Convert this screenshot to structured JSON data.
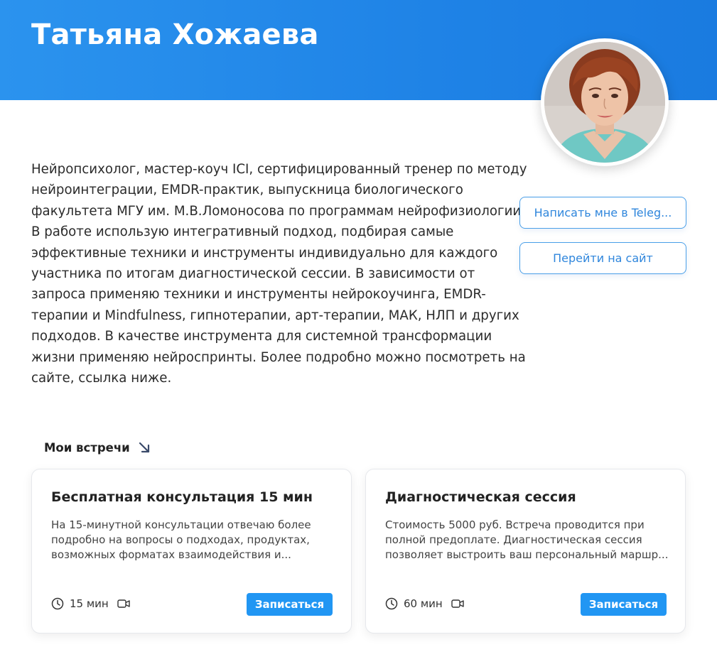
{
  "profile": {
    "name": "Татьяна Хожаева",
    "bio_lines": [
      "Нейропсихолог, мастер-коуч ICI, сертифицированный тренер по методу",
      "нейроинтеграции, EMDR-практик, выпускница биологического",
      "факультета МГУ им. М.В.Ломоносова по программам нейрофизиологии.",
      "В работе использую интегративный подход, подбирая самые",
      "эффективные техники и инструменты индивидуально для каждого",
      "участника по итогам диагностической сессии. В зависимости от",
      "запроса применяю техники и инструменты нейрокоучинга, EMDR-",
      "терапии и Mindfulness, гипнотерапии, арт-терапии, МАК, НЛП и других",
      "подходов. В качестве инструмента для системной трансформации",
      "жизни применяю нейроспринты. Более подробно можно посмотреть на",
      "сайте, ссылка ниже."
    ]
  },
  "actions": {
    "telegram_label": "Написать мне в Teleg...",
    "site_label": "Перейти на сайт"
  },
  "meetings": {
    "title": "Мои встречи",
    "cards": [
      {
        "title": "Бесплатная консультация 15 мин",
        "desc_lines": [
          "На 15-минутной консультации отвечаю более",
          "подробно на вопросы о подходах, продуктах,",
          "возможных форматах взаимодействия и..."
        ],
        "duration": "15 мин",
        "button": "Записаться"
      },
      {
        "title": "Диагностическая сессия",
        "desc_lines": [
          "Стоимость 5000 руб. Встреча проводится при",
          "полной предоплате. Диагностическая сессия",
          "позволяет выстроить ваш персональный маршр..."
        ],
        "duration": "60 мин",
        "button": "Записаться"
      }
    ]
  },
  "colors": {
    "header": "#2b93ee",
    "accent": "#2196f3",
    "button_outline": "#4a9fe8"
  },
  "icons": {
    "meetings": "arrow-down-right-icon",
    "duration": "clock-icon",
    "format": "video-camera-icon"
  }
}
